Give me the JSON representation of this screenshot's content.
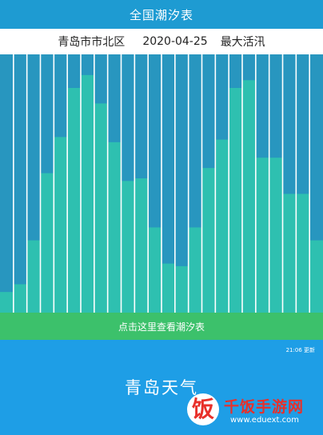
{
  "app": {
    "title": "全国潮汐表"
  },
  "info": {
    "location": "青岛市市北区",
    "date": "2020-04-25",
    "tide_type": "最大活汛"
  },
  "chart_data": {
    "type": "bar",
    "bar_count": 24,
    "values": [
      0.08,
      0.11,
      0.28,
      0.54,
      0.68,
      0.87,
      0.92,
      0.81,
      0.66,
      0.51,
      0.52,
      0.33,
      0.19,
      0.18,
      0.33,
      0.56,
      0.67,
      0.87,
      0.9,
      0.6,
      0.6,
      0.46,
      0.46,
      0.28
    ],
    "ylim": [
      0,
      1
    ],
    "colors": {
      "background": "#2896bf",
      "fill": "#2ec0b0",
      "divider": "#ffffff"
    }
  },
  "tide_link": {
    "label": "点击这里查看潮汐表"
  },
  "weather": {
    "update_time": "21:06 更新",
    "title": "青岛天气"
  },
  "watermark": {
    "glyph": "饭",
    "name": "千饭手游网",
    "url": "www.eduext.com"
  },
  "colors": {
    "title_bar": "#1e9bd2",
    "link_bar": "#3cc16b",
    "weather_panel": "#1e9ee6",
    "watermark": "#e8302a"
  }
}
